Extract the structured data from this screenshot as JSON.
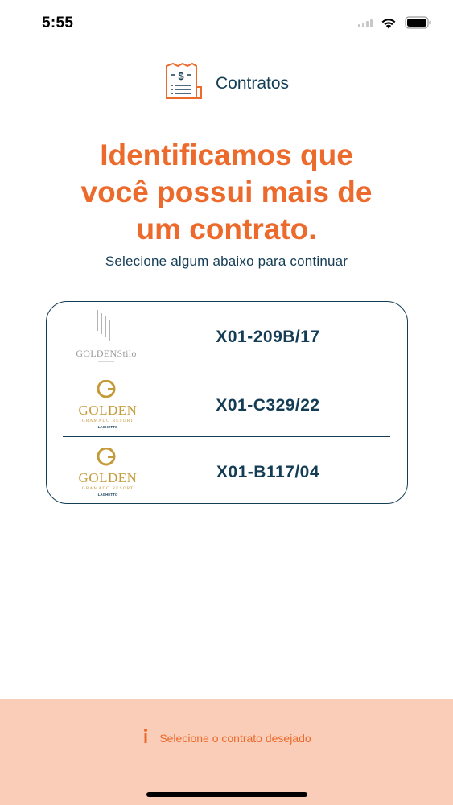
{
  "status_bar": {
    "time": "5:55"
  },
  "header": {
    "title": "Contratos"
  },
  "headline": {
    "line1": "Identificamos que",
    "line2": "você possui mais de",
    "line3": "um contrato."
  },
  "subtitle": "Selecione algum abaixo para continuar",
  "contracts": [
    {
      "code": "X01-209B/17",
      "logo_brand": "GOLDENStilo",
      "logo_icon": "golden-stilo-logo-icon"
    },
    {
      "code": "X01-C329/22",
      "logo_brand": "GOLDEN",
      "logo_subline": "GRAMADO RESORT",
      "logo_tagline": "LAGHETTO",
      "logo_icon": "golden-gramado-resort-logo-icon"
    },
    {
      "code": "X01-B117/04",
      "logo_brand": "GOLDEN",
      "logo_subline": "GRAMADO RESORT",
      "logo_tagline": "LAGHETTO",
      "logo_icon": "golden-gramado-resort-logo-icon"
    }
  ],
  "footer": {
    "info_text": "Selecione o contrato desejado",
    "info_icon": "info-icon"
  },
  "colors": {
    "accent": "#ec6a2b",
    "primary": "#143d55",
    "footer_bg": "#f9cdb8",
    "gold": "#c49a3a"
  }
}
